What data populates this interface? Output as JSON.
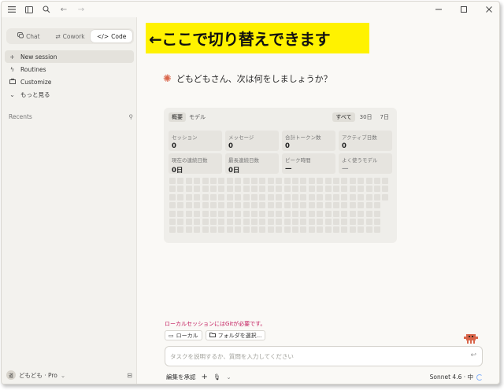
{
  "titlebar": {
    "icons": [
      "menu-icon",
      "sidebar-icon",
      "search-icon",
      "back-arrow-icon",
      "forward-arrow-icon"
    ],
    "window_controls": [
      "minimize-icon",
      "maximize-icon",
      "close-icon"
    ]
  },
  "mode_switch": {
    "chat": "Chat",
    "cowork": "Cowork",
    "code": "Code",
    "active": "Code"
  },
  "sidebar": {
    "items": [
      {
        "icon": "plus-icon",
        "label": "New session"
      },
      {
        "icon": "routines-icon",
        "label": "Routines"
      },
      {
        "icon": "briefcase-icon",
        "label": "Customize"
      },
      {
        "icon": "chevron-down-icon",
        "label": "もっと見る"
      }
    ],
    "recents_label": "Recents",
    "user": {
      "avatar_text": "道",
      "name": "どもども · Pro"
    }
  },
  "callout": {
    "text": "←ここで切り替えできます",
    "color": "#fff200"
  },
  "greeting": "どもどもさん、次は何をしましょうか？",
  "stats": {
    "tabs": [
      "概要",
      "モデル"
    ],
    "active_tab": "概要",
    "ranges": [
      "すべて",
      "30日",
      "7日"
    ],
    "active_range": "すべて",
    "cards": [
      {
        "label": "セッション",
        "value": "0"
      },
      {
        "label": "メッセージ",
        "value": "0"
      },
      {
        "label": "合計トークン数",
        "value": "0"
      },
      {
        "label": "アクティブ日数",
        "value": "0"
      },
      {
        "label": "現在の連続日数",
        "value": "0日"
      },
      {
        "label": "最長連続日数",
        "value": "0日"
      },
      {
        "label": "ピーク時間",
        "value": "—"
      },
      {
        "label": "よく使うモデル",
        "value": "—"
      }
    ]
  },
  "git_message": "ローカルセッションにはGitが必要です。",
  "chips": {
    "local": "ローカル",
    "folder": "フォルダを選択..."
  },
  "input": {
    "placeholder": "タスクを説明するか、質問を入力してください"
  },
  "bottom": {
    "edit_approval": "編集を承認",
    "model": "Sonnet 4.6 · 中"
  },
  "colors": {
    "accent_spark": "#d9654a",
    "warning_text": "#c2185b",
    "mascot": "#d9654a"
  }
}
